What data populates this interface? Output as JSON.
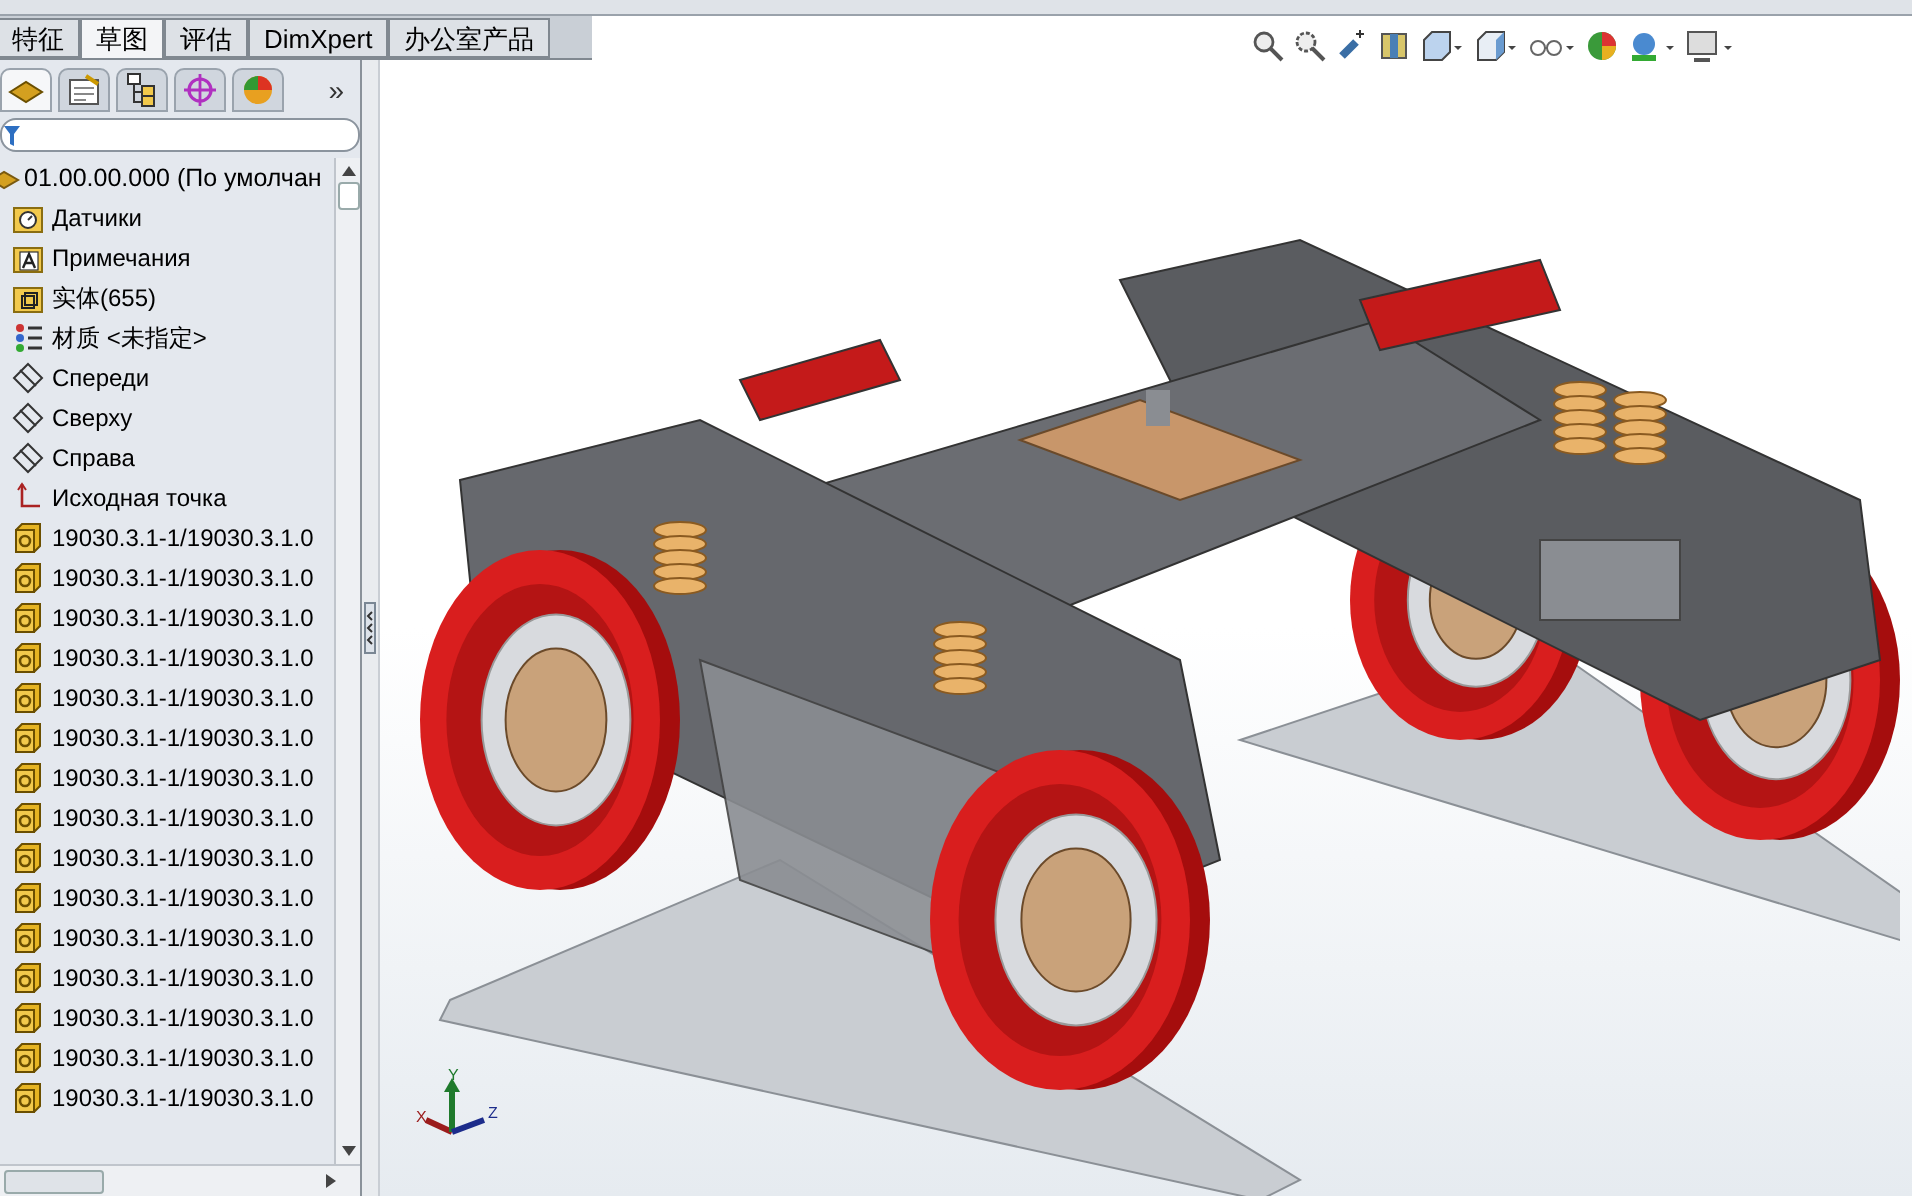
{
  "tabs": [
    {
      "label": "特征",
      "selected": false
    },
    {
      "label": "草图",
      "selected": true
    },
    {
      "label": "评估",
      "selected": false
    },
    {
      "label": "DimXpert",
      "selected": false
    },
    {
      "label": "办公室产品",
      "selected": false
    }
  ],
  "panel_tabs": [
    {
      "kind": "feature",
      "selected": true
    },
    {
      "kind": "property",
      "selected": false
    },
    {
      "kind": "config",
      "selected": false
    },
    {
      "kind": "dimxpert",
      "selected": false
    },
    {
      "kind": "display",
      "selected": false
    }
  ],
  "panel_more": "»",
  "tree": {
    "root": {
      "label": "01.00.00.000  (По умолчан",
      "kind": "assembly"
    },
    "items": [
      {
        "label": "Датчики",
        "kind": "sensor"
      },
      {
        "label": "Примечания",
        "kind": "annotation"
      },
      {
        "label": "实体(655)",
        "kind": "body"
      },
      {
        "label": "材质 <未指定>",
        "kind": "material"
      },
      {
        "label": "Спереди",
        "kind": "plane"
      },
      {
        "label": "Сверху",
        "kind": "plane"
      },
      {
        "label": "Справа",
        "kind": "plane"
      },
      {
        "label": "Исходная точка",
        "kind": "origin"
      },
      {
        "label": "19030.3.1-1/19030.3.1.0",
        "kind": "part"
      },
      {
        "label": "19030.3.1-1/19030.3.1.0",
        "kind": "part"
      },
      {
        "label": "19030.3.1-1/19030.3.1.0",
        "kind": "part"
      },
      {
        "label": "19030.3.1-1/19030.3.1.0",
        "kind": "part"
      },
      {
        "label": "19030.3.1-1/19030.3.1.0",
        "kind": "part"
      },
      {
        "label": "19030.3.1-1/19030.3.1.0",
        "kind": "part"
      },
      {
        "label": "19030.3.1-1/19030.3.1.0",
        "kind": "part"
      },
      {
        "label": "19030.3.1-1/19030.3.1.0",
        "kind": "part"
      },
      {
        "label": "19030.3.1-1/19030.3.1.0",
        "kind": "part"
      },
      {
        "label": "19030.3.1-1/19030.3.1.0",
        "kind": "part"
      },
      {
        "label": "19030.3.1-1/19030.3.1.0",
        "kind": "part"
      },
      {
        "label": "19030.3.1-1/19030.3.1.0",
        "kind": "part"
      },
      {
        "label": "19030.3.1-1/19030.3.1.0",
        "kind": "part"
      },
      {
        "label": "19030.3.1-1/19030.3.1.0",
        "kind": "part"
      },
      {
        "label": "19030.3.1-1/19030.3.1.0",
        "kind": "part"
      }
    ]
  },
  "triad": {
    "x": "X",
    "y": "Y",
    "z": "Z"
  }
}
